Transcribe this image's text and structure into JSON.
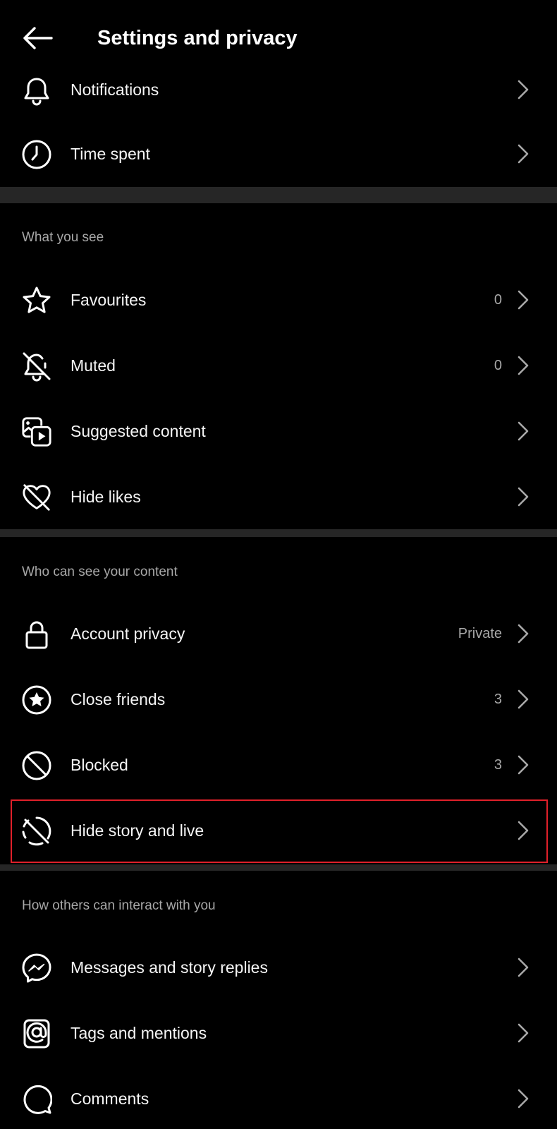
{
  "header": {
    "title": "Settings and privacy",
    "back_icon": "arrow-left-icon"
  },
  "rows_top": [
    {
      "label": "Notifications",
      "icon": "bell-icon",
      "value": ""
    },
    {
      "label": "Time spent",
      "icon": "clock-icon",
      "value": ""
    }
  ],
  "sections": [
    {
      "heading": "What you see",
      "rows": [
        {
          "label": "Favourites",
          "icon": "star-icon",
          "value": "0"
        },
        {
          "label": "Muted",
          "icon": "bell-off-icon",
          "value": "0"
        },
        {
          "label": "Suggested content",
          "icon": "media-play-icon",
          "value": ""
        },
        {
          "label": "Hide likes",
          "icon": "heart-off-icon",
          "value": ""
        }
      ]
    },
    {
      "heading": "Who can see your content",
      "rows": [
        {
          "label": "Account privacy",
          "icon": "lock-icon",
          "value": "Private"
        },
        {
          "label": "Close friends",
          "icon": "circle-star-icon",
          "value": "3"
        },
        {
          "label": "Blocked",
          "icon": "blocked-icon",
          "value": "3"
        },
        {
          "label": "Hide story and live",
          "icon": "story-off-icon",
          "value": ""
        }
      ]
    },
    {
      "heading": "How others can interact with you",
      "rows": [
        {
          "label": "Messages and story replies",
          "icon": "messenger-icon",
          "value": ""
        },
        {
          "label": "Tags and mentions",
          "icon": "at-sign-icon",
          "value": ""
        },
        {
          "label": "Comments",
          "icon": "comment-icon",
          "value": ""
        }
      ]
    }
  ],
  "colors": {
    "background": "#000000",
    "text": "#f5f5f5",
    "secondary_text": "#a8a8a8",
    "divider": "#262626",
    "highlight_border": "#e0202a"
  }
}
